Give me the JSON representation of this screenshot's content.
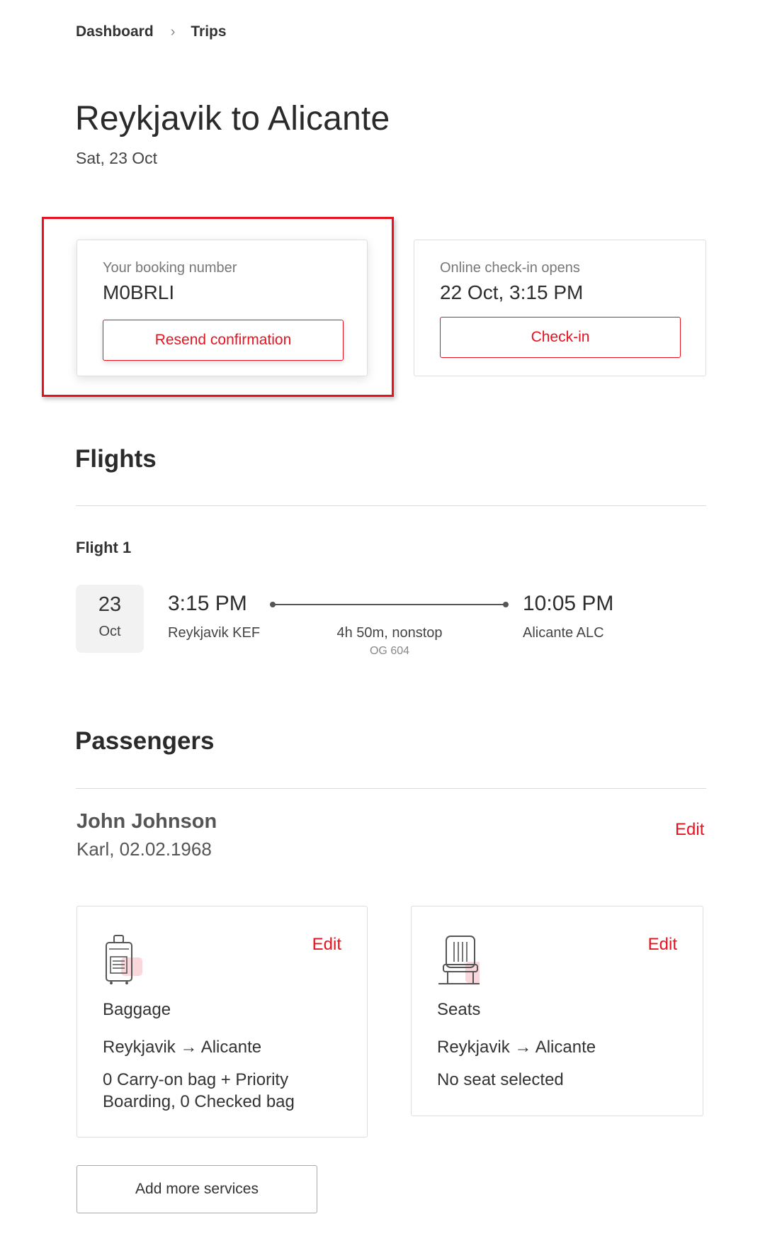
{
  "breadcrumb": {
    "items": [
      "Dashboard",
      "Trips"
    ],
    "separator": "›"
  },
  "header": {
    "title": "Reykjavik to Alicante",
    "date": "Sat, 23 Oct"
  },
  "booking": {
    "label": "Your booking number",
    "number": "M0BRLI",
    "resend_label": "Resend confirmation"
  },
  "checkin": {
    "label": "Online check-in opens",
    "opens": "22 Oct, 3:15 PM",
    "button_label": "Check-in"
  },
  "flights": {
    "section_title": "Flights",
    "items": [
      {
        "label": "Flight 1",
        "day": "23",
        "month": "Oct",
        "depart_time": "3:15 PM",
        "depart_airport": "Reykjavik KEF",
        "arrive_time": "10:05 PM",
        "arrive_airport": "Alicante ALC",
        "duration": "4h 50m, nonstop",
        "flight_number": "OG 604"
      }
    ]
  },
  "passengers": {
    "section_title": "Passengers",
    "items": [
      {
        "name": "John Johnson",
        "subtitle": "Karl, 02.02.1968",
        "edit_label": "Edit",
        "services": {
          "baggage": {
            "icon": "luggage-icon",
            "title": "Baggage",
            "route": "Reykjavik → Alicante",
            "detail": "0 Carry-on bag + Priority Boarding, 0 Checked bag",
            "edit_label": "Edit"
          },
          "seats": {
            "icon": "seat-icon",
            "title": "Seats",
            "route": "Reykjavik → Alicante",
            "detail": "No seat selected",
            "edit_label": "Edit"
          }
        }
      }
    ]
  },
  "add_more_label": "Add more services",
  "colors": {
    "accent": "#e8121f",
    "icon_tint": "#f9d7da"
  }
}
